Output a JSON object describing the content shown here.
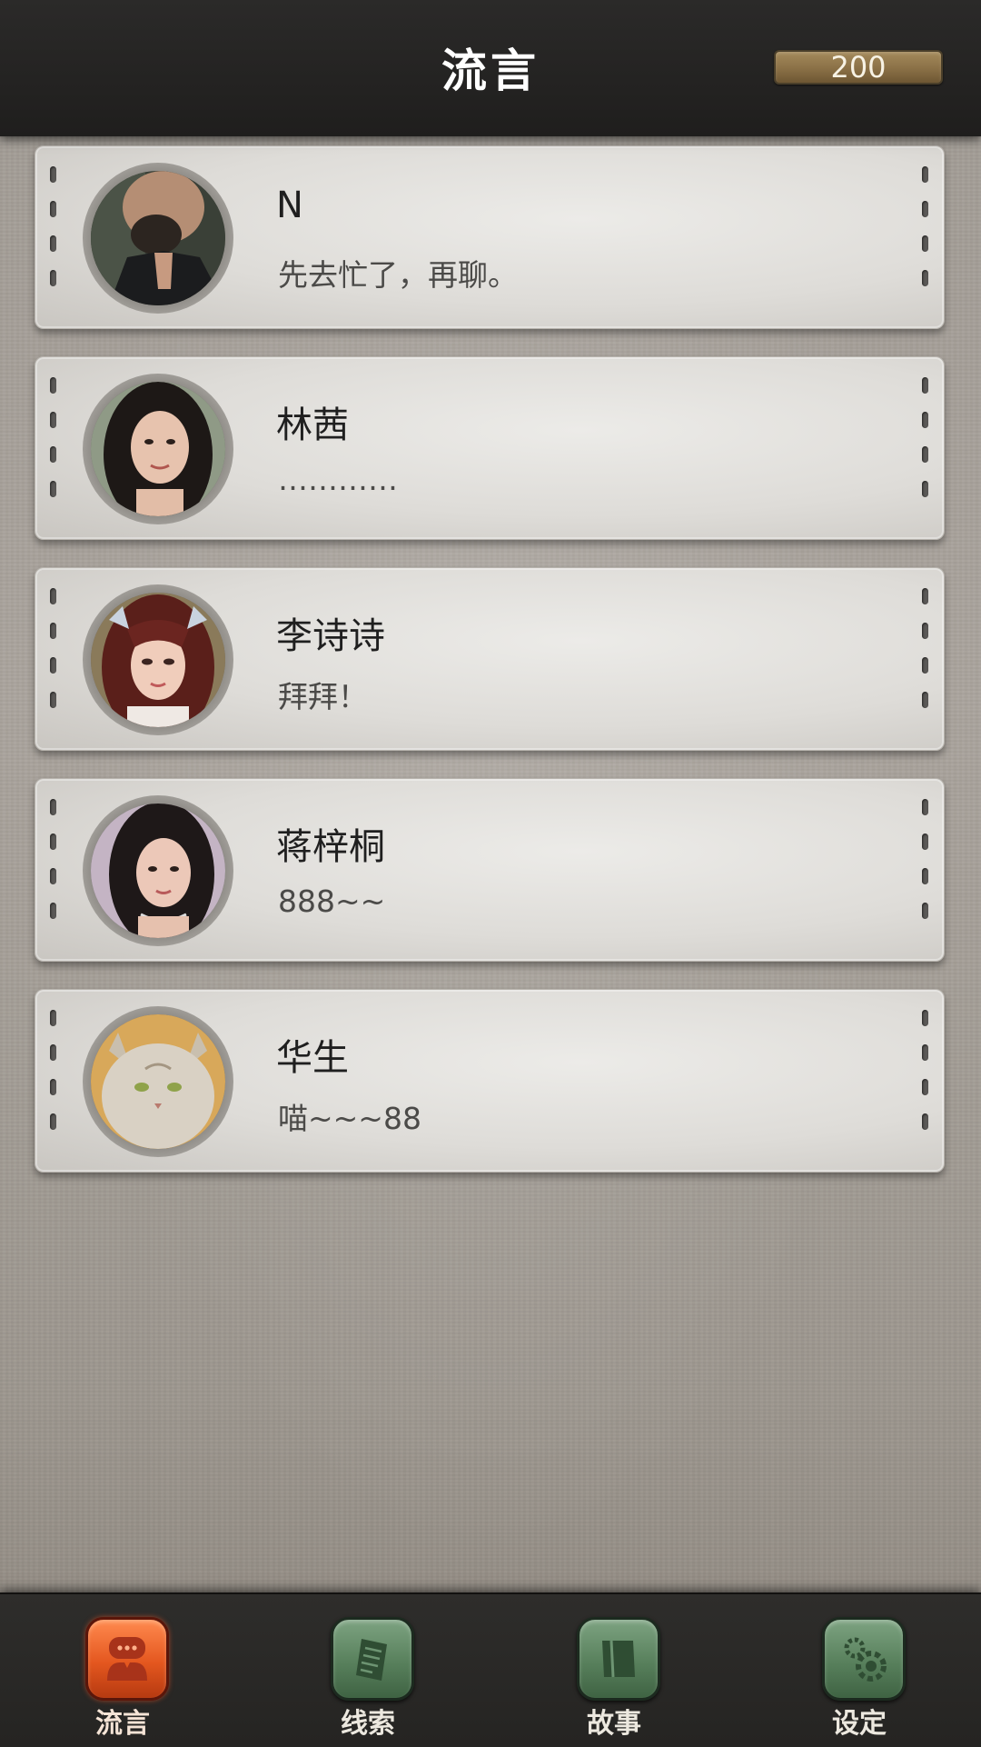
{
  "header": {
    "title": "流言",
    "coins": "200"
  },
  "contacts": [
    {
      "name": "N",
      "message": "先去忙了，再聊。",
      "avatar": "man-portrait-avatar"
    },
    {
      "name": "林茜",
      "message": "…………",
      "avatar": "woman-portrait-avatar"
    },
    {
      "name": "李诗诗",
      "message": "拜拜！",
      "avatar": "woman-portrait-avatar"
    },
    {
      "name": "蒋梓桐",
      "message": "888~~",
      "avatar": "woman-portrait-avatar"
    },
    {
      "name": "华生",
      "message": "喵~~~88",
      "avatar": "cat-portrait-avatar"
    }
  ],
  "nav": {
    "tabs": [
      {
        "label": "流言",
        "icon": "chat-bubble-icon",
        "active": true
      },
      {
        "label": "线索",
        "icon": "clue-paper-icon",
        "active": false
      },
      {
        "label": "故事",
        "icon": "story-book-icon",
        "active": false
      },
      {
        "label": "设定",
        "icon": "settings-gear-icon",
        "active": false
      }
    ]
  },
  "colors": {
    "active_tab": "#e4571f",
    "inactive_tab": "#58805c",
    "coin_bar": "#8a7046"
  }
}
